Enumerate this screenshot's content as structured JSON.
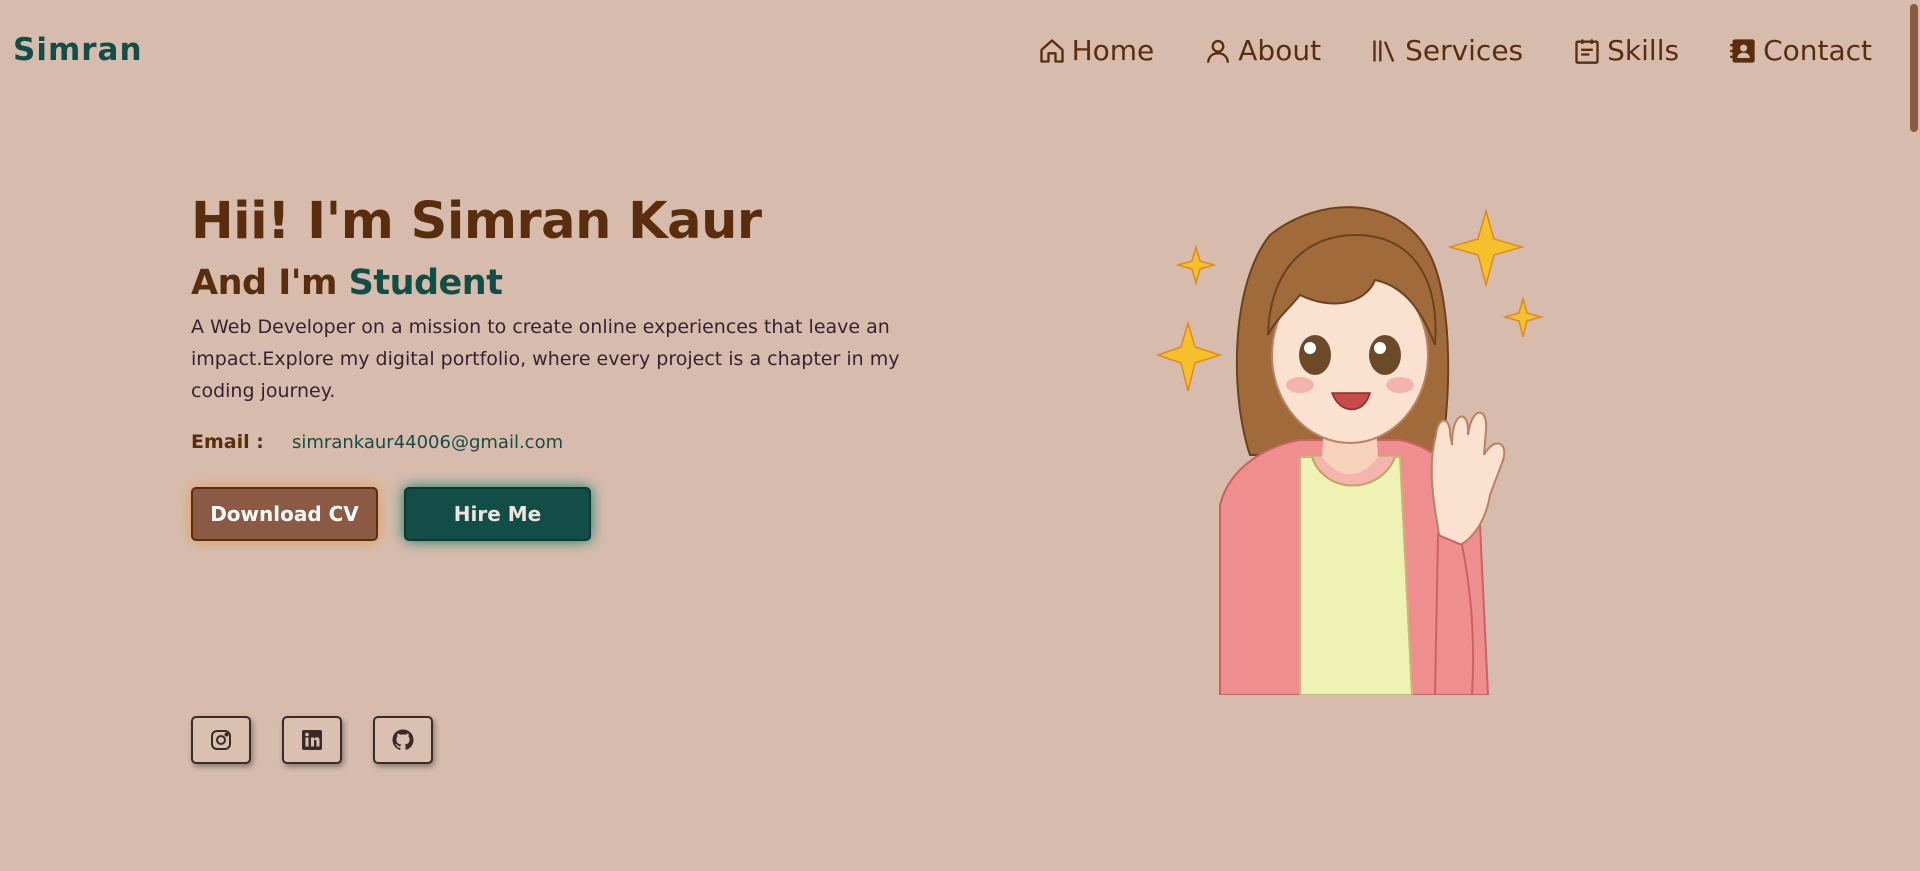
{
  "brand": {
    "name": "Simran"
  },
  "nav": {
    "items": [
      {
        "label": "Home",
        "icon": "home-icon"
      },
      {
        "label": "About",
        "icon": "user-icon"
      },
      {
        "label": "Services",
        "icon": "books-icon"
      },
      {
        "label": "Skills",
        "icon": "calendar-icon"
      },
      {
        "label": "Contact",
        "icon": "contact-book-icon"
      }
    ]
  },
  "hero": {
    "greeting": "Hii! I'm Simran Kaur",
    "subtitle_prefix": "And I'm ",
    "role": "Student",
    "description": "A Web Developer on a mission to create online experiences that leave an impact.Explore my digital portfolio, where every project is a chapter in my coding journey.",
    "email_label": "Email :",
    "email_value": "simrankaur44006@gmail.com",
    "download_cv": "Download CV",
    "hire_me": "Hire Me"
  },
  "socials": [
    {
      "icon": "instagram-icon"
    },
    {
      "icon": "linkedin-icon"
    },
    {
      "icon": "github-icon"
    }
  ],
  "colors": {
    "background": "#d7bcad",
    "primary_text": "#5a2e0c",
    "accent": "#124e47",
    "cv_button": "#8b5a45"
  }
}
